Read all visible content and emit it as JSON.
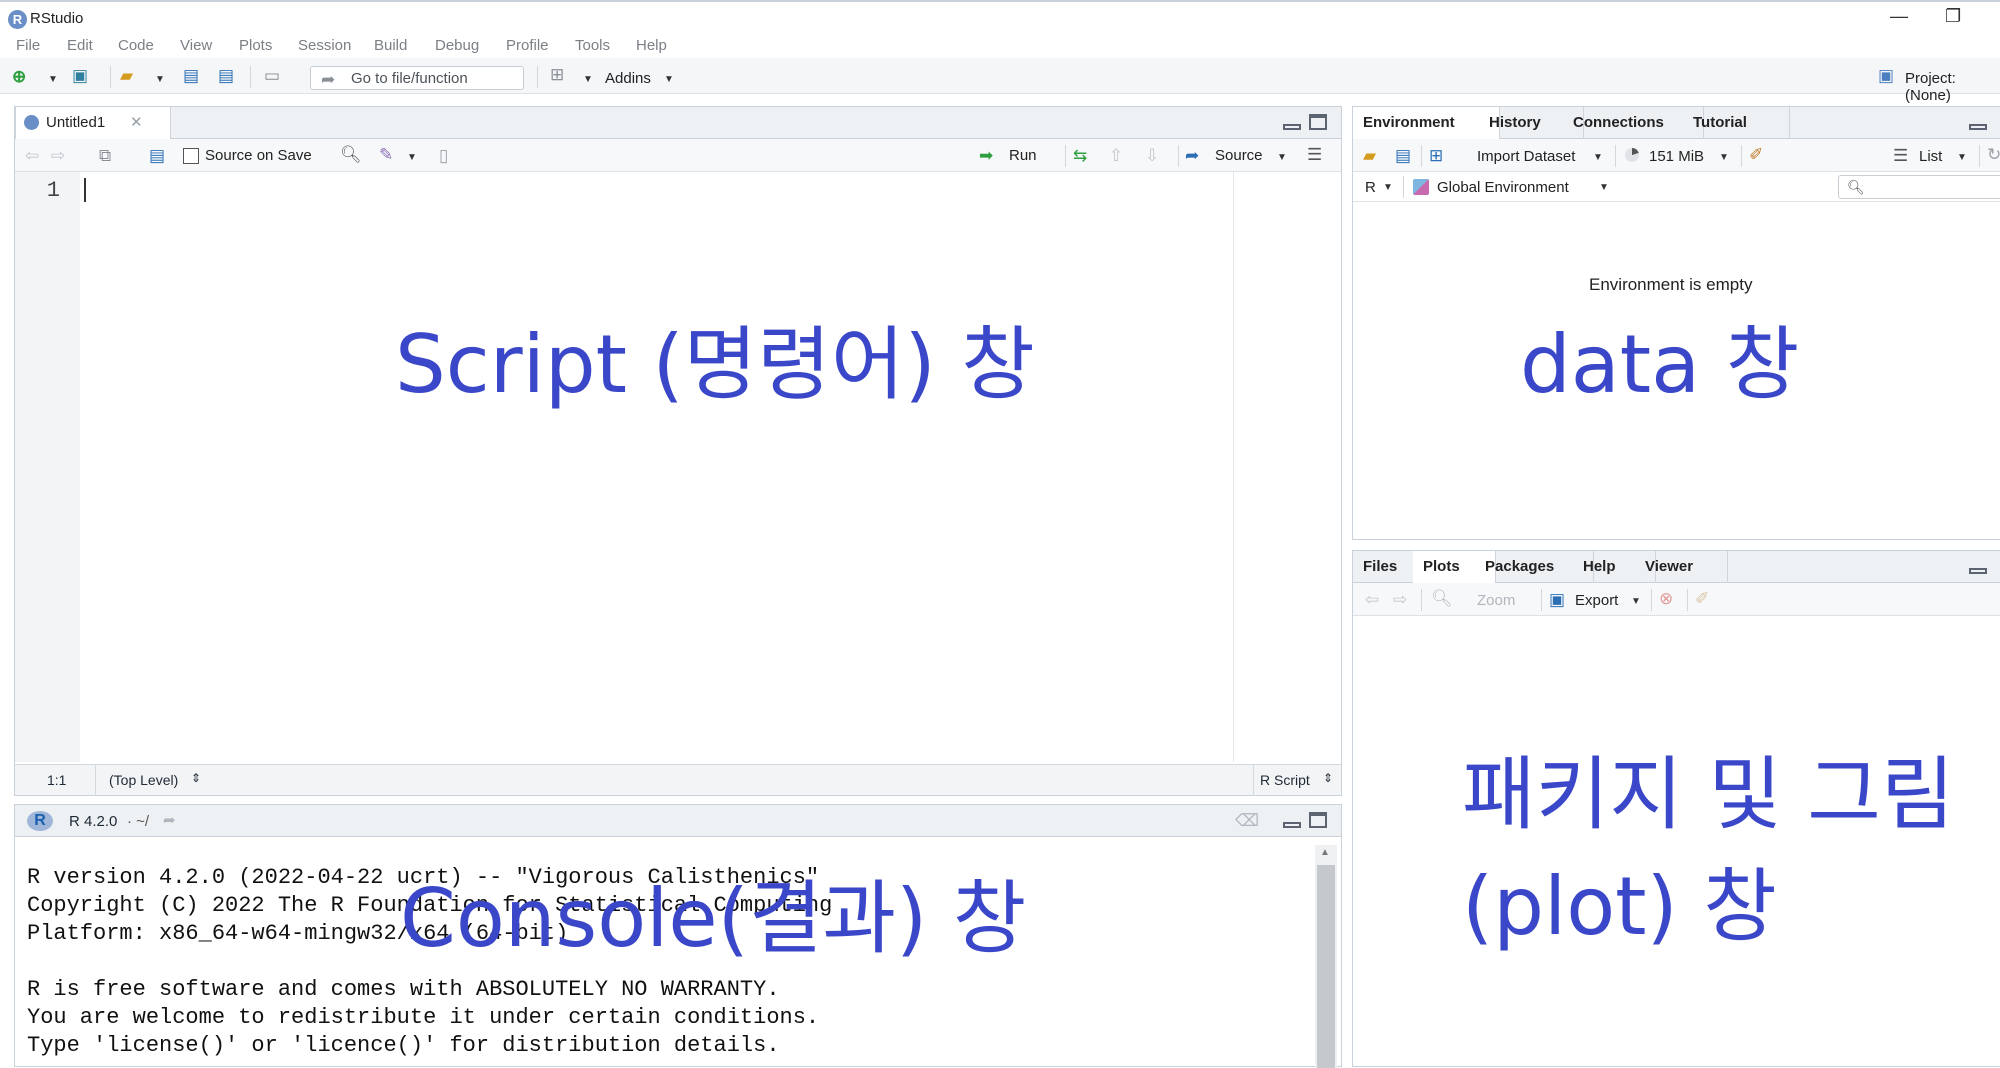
{
  "window": {
    "title": "RStudio",
    "minimize": "—",
    "restore": "❐"
  },
  "menu": [
    "File",
    "Edit",
    "Code",
    "View",
    "Plots",
    "Session",
    "Build",
    "Debug",
    "Profile",
    "Tools",
    "Help"
  ],
  "toolbar": {
    "goto_placeholder": "Go to file/function",
    "addins": "Addins",
    "project": "Project: (None)"
  },
  "editor": {
    "tab": "Untitled1",
    "source_on_save": "Source on Save",
    "run": "Run",
    "source": "Source",
    "line_number": "1",
    "cursor_pos": "1:1",
    "scope": "(Top Level)",
    "file_type": "R Script"
  },
  "console": {
    "version": "R 4.2.0",
    "path": "· ~/",
    "lines": [
      "R version 4.2.0 (2022-04-22 ucrt) -- \"Vigorous Calisthenics\"",
      "Copyright (C) 2022 The R Foundation for Statistical Computing",
      "Platform: x86_64-w64-mingw32/x64 (64-bit)",
      "",
      "R is free software and comes with ABSOLUTELY NO WARRANTY.",
      "You are welcome to redistribute it under certain conditions.",
      "Type 'license()' or 'licence()' for distribution details."
    ]
  },
  "env_pane": {
    "tabs": [
      "Environment",
      "History",
      "Connections",
      "Tutorial"
    ],
    "import_dataset": "Import Dataset",
    "memory": "151 MiB",
    "list": "List",
    "language": "R",
    "global_env": "Global Environment",
    "empty_msg": "Environment is empty"
  },
  "files_pane": {
    "tabs": [
      "Files",
      "Plots",
      "Packages",
      "Help",
      "Viewer"
    ],
    "zoom": "Zoom",
    "export": "Export"
  },
  "annotations": {
    "script": "Script (명령어) 창",
    "data": "data 창",
    "console": "Console(결과) 창",
    "packages_line1": "패키지 및 그림",
    "packages_line2": "(plot) 창",
    "color": "#3a47c9"
  }
}
